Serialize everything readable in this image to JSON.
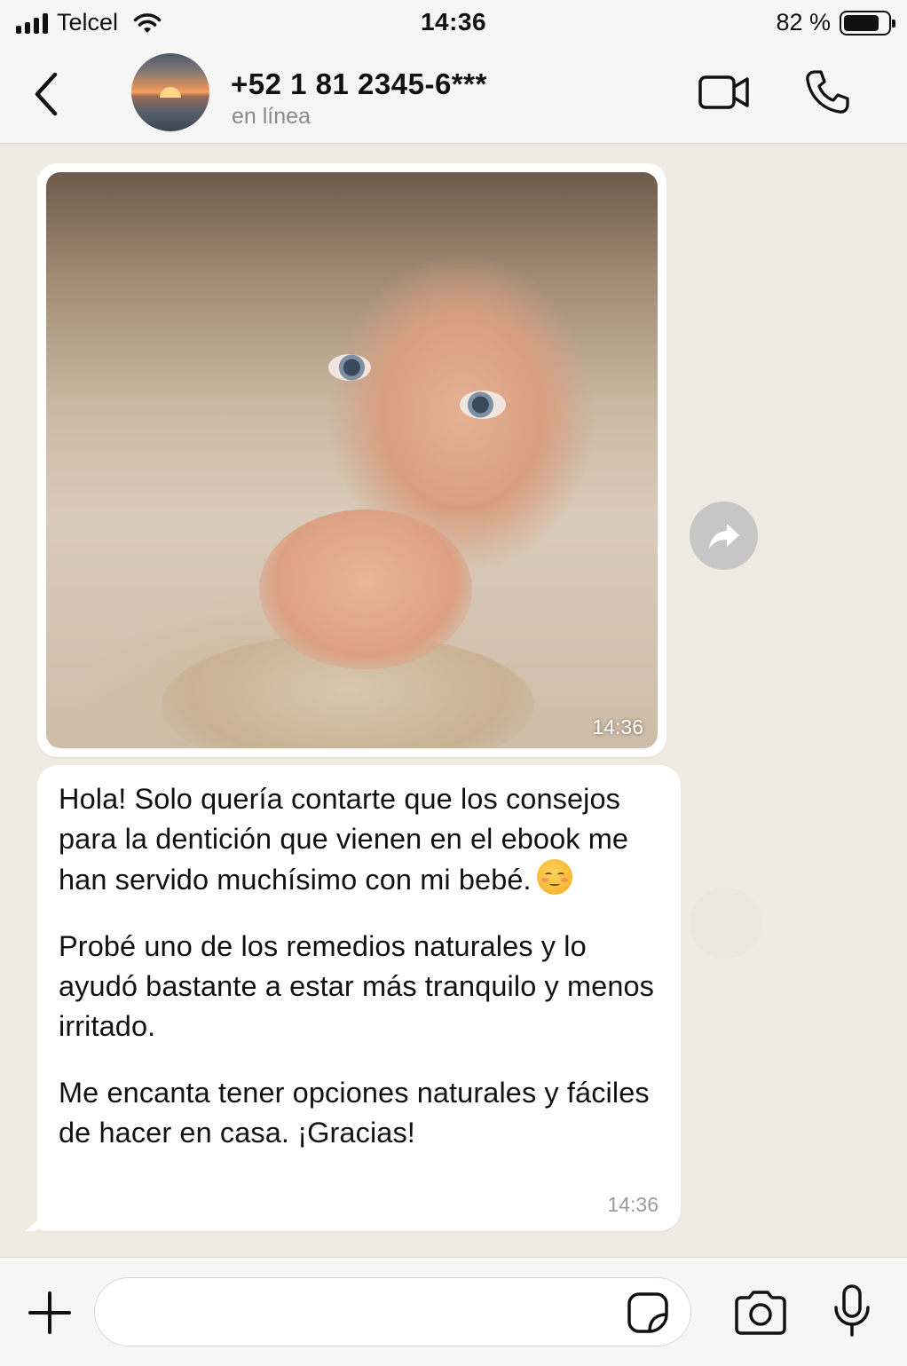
{
  "status_bar": {
    "carrier": "Telcel",
    "time": "14:36",
    "battery_percent": "82 %",
    "battery_level": 0.82,
    "signal_icon": "signal-bars-icon",
    "wifi_icon": "wifi-icon"
  },
  "header": {
    "back_icon": "chevron-left-icon",
    "contact_name": "+52 1 81 2345-6***",
    "contact_status": "en línea",
    "video_icon": "video-camera-icon",
    "call_icon": "phone-icon"
  },
  "messages": [
    {
      "type": "image",
      "time": "14:36",
      "forward_icon": "forward-arrow-icon"
    },
    {
      "type": "text",
      "paragraphs": [
        "Hola! Solo quería contarte que los consejos para la dentición que vienen en el ebook me han servido muchísimo con mi bebé.",
        "Probé uno de los remedios naturales y lo ayudó bastante a estar más tranquilo y menos irritado.",
        "Me encanta tener opciones naturales y fáciles de hacer en casa. ¡Gracias!"
      ],
      "time": "14:36"
    }
  ],
  "input_bar": {
    "plus_icon": "plus-icon",
    "placeholder": "",
    "sticker_icon": "sticker-icon",
    "camera_icon": "camera-icon",
    "mic_icon": "microphone-icon"
  },
  "colors": {
    "chat_background": "#efeae2",
    "bubble": "#ffffff",
    "bars": "#f6f6f6",
    "muted_text": "#8a8a8a"
  }
}
